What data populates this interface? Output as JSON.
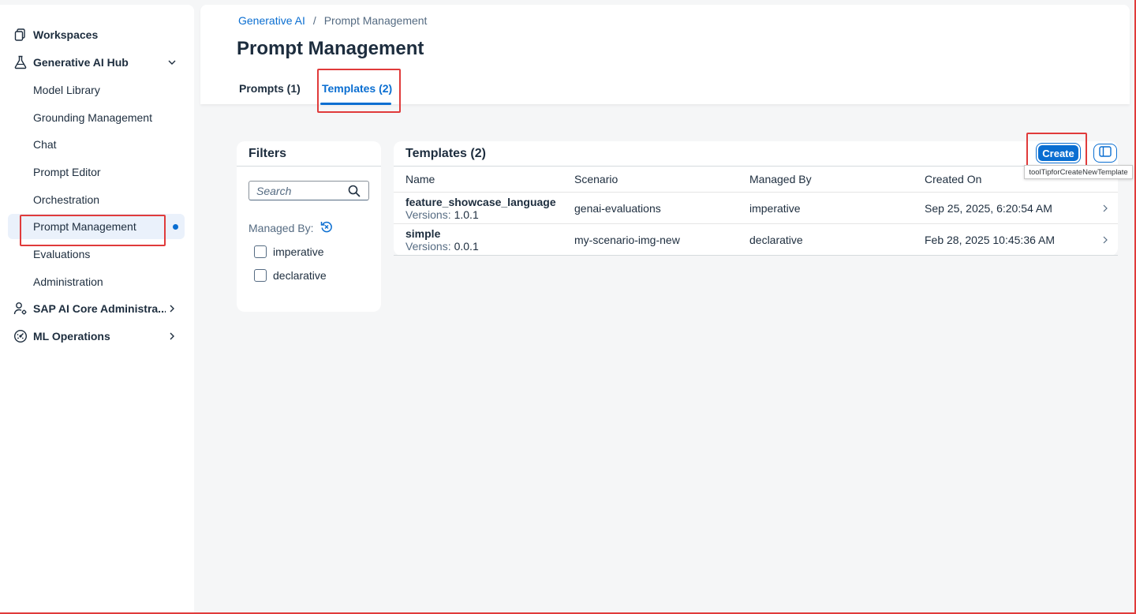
{
  "sidebar": {
    "items": [
      {
        "label": "Workspaces",
        "icon": "workspaces-icon"
      },
      {
        "label": "Generative AI Hub",
        "icon": "flask-icon",
        "expanded": true
      },
      {
        "label": "Model Library"
      },
      {
        "label": "Grounding Management"
      },
      {
        "label": "Chat"
      },
      {
        "label": "Prompt Editor"
      },
      {
        "label": "Orchestration"
      },
      {
        "label": "Prompt Management",
        "selected": true
      },
      {
        "label": "Evaluations"
      },
      {
        "label": "Administration"
      },
      {
        "label": "SAP AI Core Administra...",
        "icon": "user-settings-icon"
      },
      {
        "label": "ML Operations",
        "icon": "ml-operations-icon"
      }
    ]
  },
  "header": {
    "breadcrumb": {
      "link": "Generative AI",
      "separator": "/",
      "current": "Prompt Management"
    },
    "title": "Prompt Management",
    "tabs": [
      {
        "label": "Prompts (1)",
        "active": false
      },
      {
        "label": "Templates (2)",
        "active": true
      }
    ]
  },
  "filters": {
    "title": "Filters",
    "search_placeholder": "Search",
    "managed_by_label": "Managed By:",
    "options": [
      "imperative",
      "declarative"
    ]
  },
  "templates": {
    "title": "Templates (2)",
    "create_label": "Create",
    "tooltip": "toolTipforCreateNewTemplate",
    "columns": [
      "Name",
      "Scenario",
      "Managed By",
      "Created On"
    ],
    "version_label": "Versions:",
    "rows": [
      {
        "name": "feature_showcase_language",
        "version": "1.0.1",
        "scenario": "genai-evaluations",
        "managed_by": "imperative",
        "created_on": "Sep 25, 2025, 6:20:54 AM"
      },
      {
        "name": "simple",
        "version": "0.0.1",
        "scenario": "my-scenario-img-new",
        "managed_by": "declarative",
        "created_on": "Feb 28, 2025 10:45:36 AM"
      }
    ]
  },
  "colors": {
    "accent": "#0a6ed1",
    "highlight_box": "#e03b3b",
    "text": "#1d2d3e",
    "muted": "#556b82"
  }
}
